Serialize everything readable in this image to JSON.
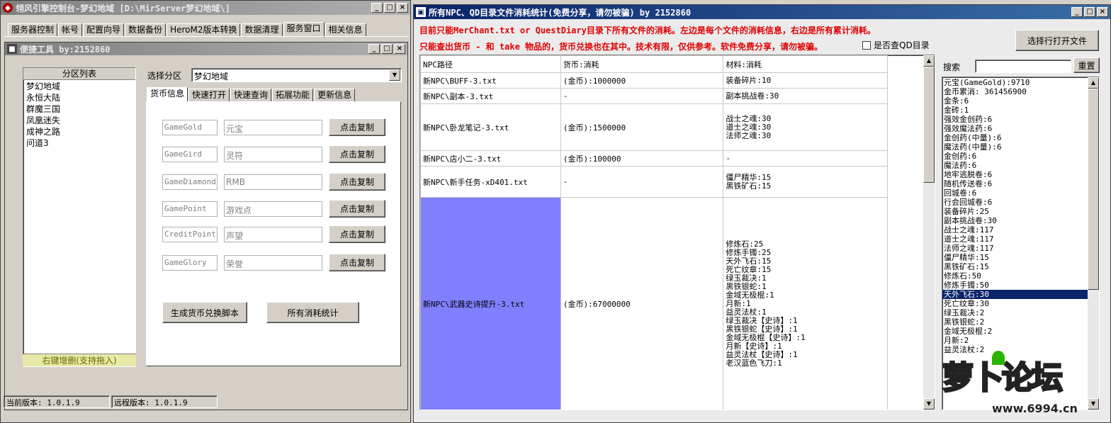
{
  "main_window": {
    "title": "翎风引擎控制台-梦幻地域 [D:\\MirServer梦幻地域\\]",
    "menu_tabs": [
      "服务器控制",
      "帐号",
      "配置向导",
      "数据备份",
      "HeroM2版本转换",
      "数据清理",
      "服务窗口",
      "相关信息"
    ],
    "selected_tab": 6
  },
  "tool_window": {
    "title": "便捷工具   by:2152860",
    "zone_list_header": "分区列表",
    "zones": [
      "梦幻地域",
      "永恒大陆",
      "群魔三国",
      "凤凰迷失",
      "成神之路",
      "问道3"
    ],
    "zone_footer": "右键增删(支持拖入)",
    "select_zone_label": "选择分区",
    "select_zone_value": "梦幻地域",
    "tabs": [
      "货币信息",
      "快速打开",
      "快速查询",
      "拓展功能",
      "更新信息"
    ],
    "currency_rows": [
      {
        "code": "GameGold",
        "name": "元宝",
        "button": "点击复制"
      },
      {
        "code": "GameGird",
        "name": "灵符",
        "button": "点击复制"
      },
      {
        "code": "GameDiamond",
        "name": "RMB",
        "button": "点击复制"
      },
      {
        "code": "GamePoint",
        "name": "游戏点",
        "button": "点击复制"
      },
      {
        "code": "CreditPoint",
        "name": "声望",
        "button": "点击复制"
      },
      {
        "code": "GameGlory",
        "name": "荣誉",
        "button": "点击复制"
      }
    ],
    "gen_script_button": "生成货币兑换脚本",
    "all_stats_button": "所有消耗统计",
    "status_current": "当前版本: 1.0.1.9",
    "status_remote": "远程版本: 1.0.1.9"
  },
  "stats_window": {
    "title": "所有NPC、QD目录文件消耗统计(免费分享，请勿被骗)    by 2152860",
    "notice1": "目前只能MerChant.txt or QuestDiary目录下所有文件的消耗。左边是每个文件的消耗信息，右边是所有累计消耗。",
    "notice2": "只能查出货币 - 和 take 物品的，货币兑换也在其中。技术有限，仅供参考。软件免费分享，请勿被骗。",
    "checkbox_label": "是否查QD目录",
    "open_file_button": "选择行打开文件",
    "search_label": "搜索",
    "reset_button": "重置",
    "table_headers": [
      "NPC路径",
      "货币:消耗",
      "材料:消耗"
    ],
    "rows": [
      {
        "path": "新NPC\\BUFF-3.txt",
        "currency": "(金币):1000000",
        "materials": [
          "装备碎片:10"
        ]
      },
      {
        "path": "新NPC\\副本-3.txt",
        "currency": "-",
        "materials": [
          "副本挑战卷:30"
        ]
      },
      {
        "path": "新NPC\\卧龙笔记-3.txt",
        "currency": "(金币):1500000",
        "materials": [
          "战士之魂:30",
          "道士之魂:30",
          "法师之魂:30"
        ]
      },
      {
        "path": "新NPC\\店小二-3.txt",
        "currency": "(金币):100000",
        "materials": [
          "-"
        ]
      },
      {
        "path": "新NPC\\新手任务-xD401.txt",
        "currency": "-",
        "materials": [
          "僵尸精华:15",
          "黑铁矿石:15"
        ]
      },
      {
        "path": "新NPC\\武器史诗提升-3.txt",
        "currency": "(金币):67000000",
        "materials": [
          "修炼石:25",
          "修炼手镯:25",
          "天外飞石:15",
          "死亡纹章:15",
          "绿玉裁决:1",
          "黑铁银蛇:1",
          "金域无极棍:1",
          "月新:1",
          "益灵法杖:1",
          "绿玉裁决【史诗】:1",
          "黑铁银蛇【史诗】:1",
          "金域无极棍【史诗】:1",
          "月新【史诗】:1",
          "益灵法杖【史诗】:1",
          "老汉蓝色飞刀:1"
        ]
      }
    ],
    "totals": [
      "元宝(GameGold):9710",
      "金币累消: 361456900",
      "金条:6",
      "金砖:1",
      "强效金创药:6",
      "强效魔法药:6",
      "金创药(中量):6",
      "魔法药(中量):6",
      "金创药:6",
      "魔法药:6",
      "地牢逃脱卷:6",
      "随机传送卷:6",
      "回城卷:6",
      "行会回城卷:6",
      "装备碎片:25",
      "副本挑战卷:30",
      "战士之魂:117",
      "道士之魂:117",
      "法师之魂:117",
      "僵尸精华:15",
      "黑铁矿石:15",
      "修炼石:50",
      "修炼手镯:50",
      "天外飞石:30",
      "死亡纹章:30",
      "绿玉裁决:2",
      "黑铁银蛇:2",
      "金域无极棍:2",
      "月新:2",
      "益灵法杖:2"
    ],
    "highlighted_total": 23
  },
  "watermark": {
    "brand": "萝卜论坛",
    "url": "www.6994.cn"
  }
}
